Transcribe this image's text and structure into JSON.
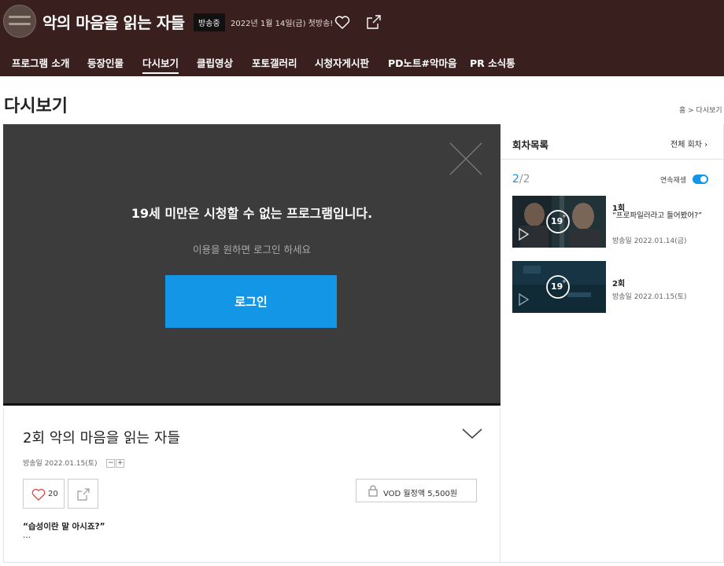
{
  "header": {
    "program_title": "악의 마음을 읽는 자들",
    "status_badge": "방송중",
    "air_info": "2022년 1월 14일(금) 첫방송!",
    "nav": [
      "프로그램 소개",
      "등장인물",
      "다시보기",
      "클립영상",
      "포토갤러리",
      "시청자게시판",
      "PD노트#악마음",
      "PR 소식통"
    ],
    "active_tab": "다시보기"
  },
  "page": {
    "title": "다시보기",
    "breadcrumb": "홈 > 다시보기"
  },
  "player": {
    "restriction_message": "19세 미만은 시청할 수 없는 프로그램입니다.",
    "login_prompt": "이용을 원하면 로그인 하세요",
    "login_button": "로그인"
  },
  "episode": {
    "title": "2회 악의 마음을 읽는 자들",
    "air_date": "방송일 2022.01.15(토)",
    "font_minus": "−",
    "font_plus": "+",
    "likes": "20",
    "vod_label": "VOD 월정액 5,500원",
    "quote": "“습성이란 말 아시죠?”",
    "ellipsis": "…"
  },
  "sidebar": {
    "title": "회차목록",
    "all_link": "전체 회차 ›",
    "counter_current": "2",
    "counter_total": "/2",
    "autoplay_label": "연속재생",
    "autoplay_on": true,
    "episodes": [
      {
        "number": "1회",
        "subtitle": "“프로파일러라고 들어봤어?”",
        "air_date": "방송일 2022.01.14(금)",
        "rating": "19"
      },
      {
        "number": "2회",
        "subtitle": "",
        "air_date": "방송일 2022.01.15(토)",
        "rating": "19"
      }
    ]
  },
  "colors": {
    "header_bg": "#3a1f1f",
    "accent_blue": "#1496e6",
    "player_bg": "#3c3c3c"
  },
  "icons": [
    "heart-icon",
    "share-icon",
    "close-icon",
    "chevron-down-icon",
    "lock-icon",
    "play-icon"
  ]
}
